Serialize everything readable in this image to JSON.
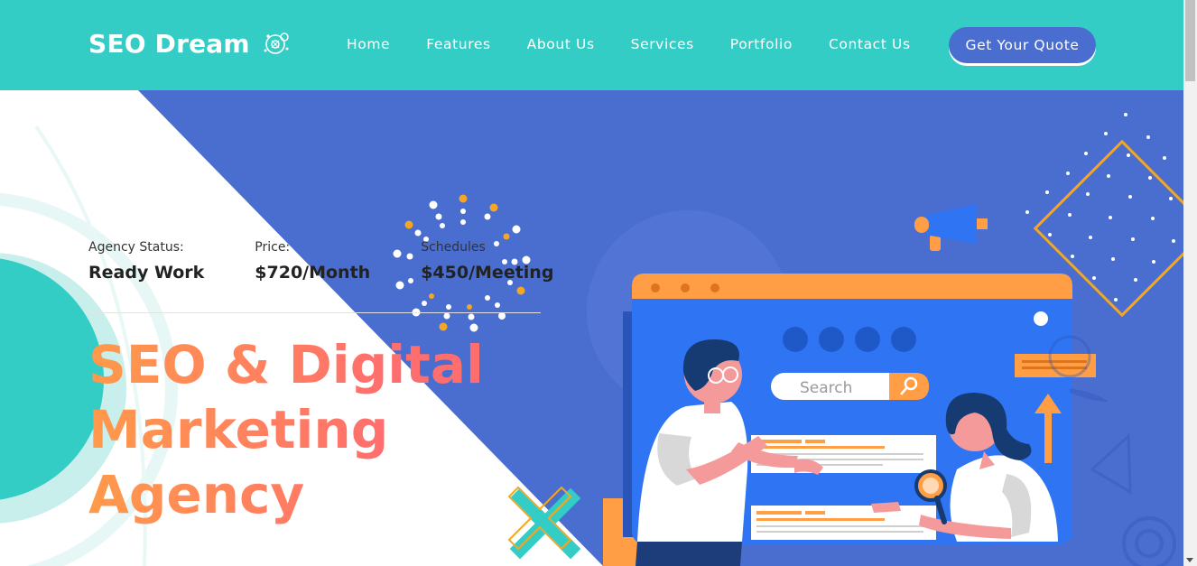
{
  "header": {
    "logo_text": "SEO Dream",
    "nav": [
      {
        "label": "Home"
      },
      {
        "label": "Features"
      },
      {
        "label": "About Us"
      },
      {
        "label": "Services"
      },
      {
        "label": "Portfolio"
      },
      {
        "label": "Contact Us"
      }
    ],
    "quote_button": "Get Your Quote"
  },
  "hero": {
    "stats": [
      {
        "label": "Agency Status:",
        "value": "Ready Work"
      },
      {
        "label": "Price:",
        "value": "$720/Month"
      },
      {
        "label": "Schedules",
        "value": "$450/Meeting"
      }
    ],
    "title_lines": [
      "SEO & Digital",
      "Marketing",
      "Agency"
    ],
    "illustration": {
      "search_placeholder": "Search"
    }
  },
  "colors": {
    "header_bg": "#33cdc6",
    "hero_blue": "#4a6dd0",
    "accent_orange": "#ff9a4a",
    "button_blue": "#4a6dd0"
  },
  "icons": {
    "logo_icon": "gears-icon",
    "search_icon": "search-icon",
    "megaphone_icon": "megaphone-icon"
  }
}
